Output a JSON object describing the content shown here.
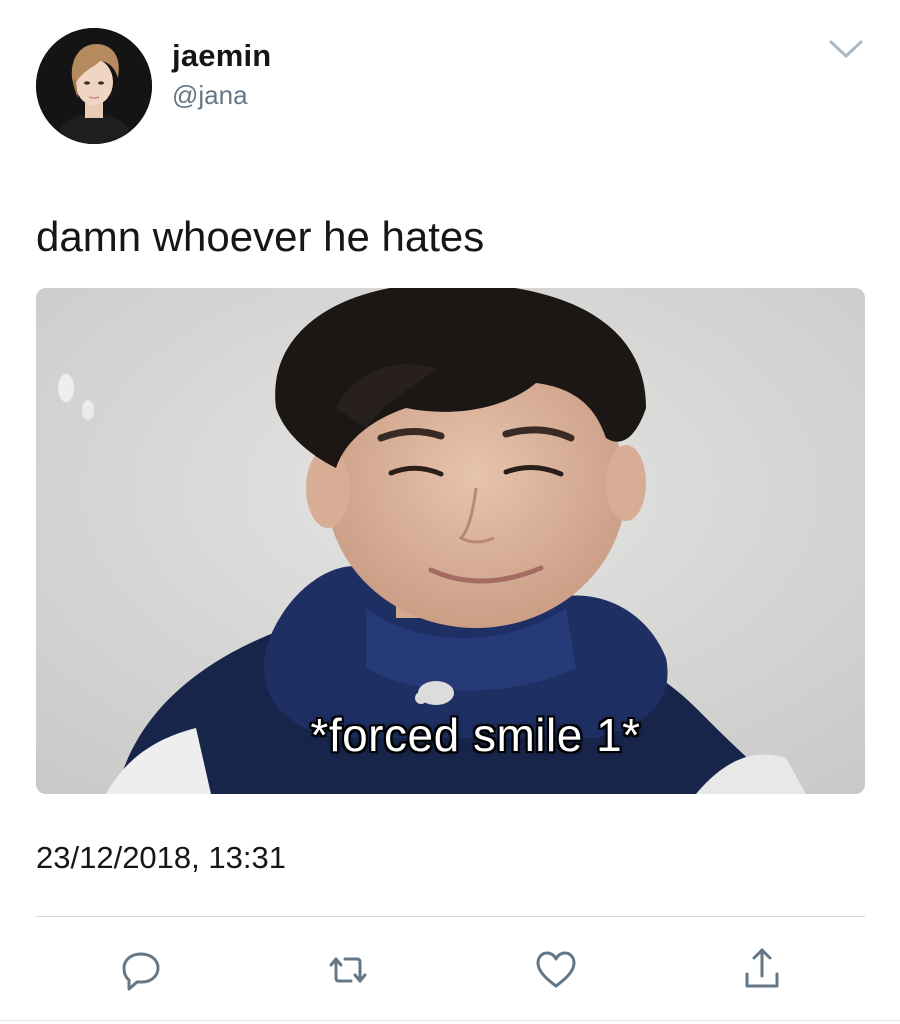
{
  "user": {
    "display_name": "jaemin",
    "handle": "@jana"
  },
  "tweet": {
    "text": "damn whoever he hates",
    "media_caption": "*forced smile 1*",
    "timestamp": "23/12/2018, 13:31"
  },
  "icons": {
    "menu": "chevron-down-icon",
    "reply": "reply-icon",
    "retweet": "retweet-icon",
    "like": "heart-icon",
    "share": "share-icon"
  },
  "colors": {
    "text_primary": "#14171a",
    "text_secondary": "#657786",
    "icon_gray": "#657786",
    "divider": "#d6d9dc"
  }
}
